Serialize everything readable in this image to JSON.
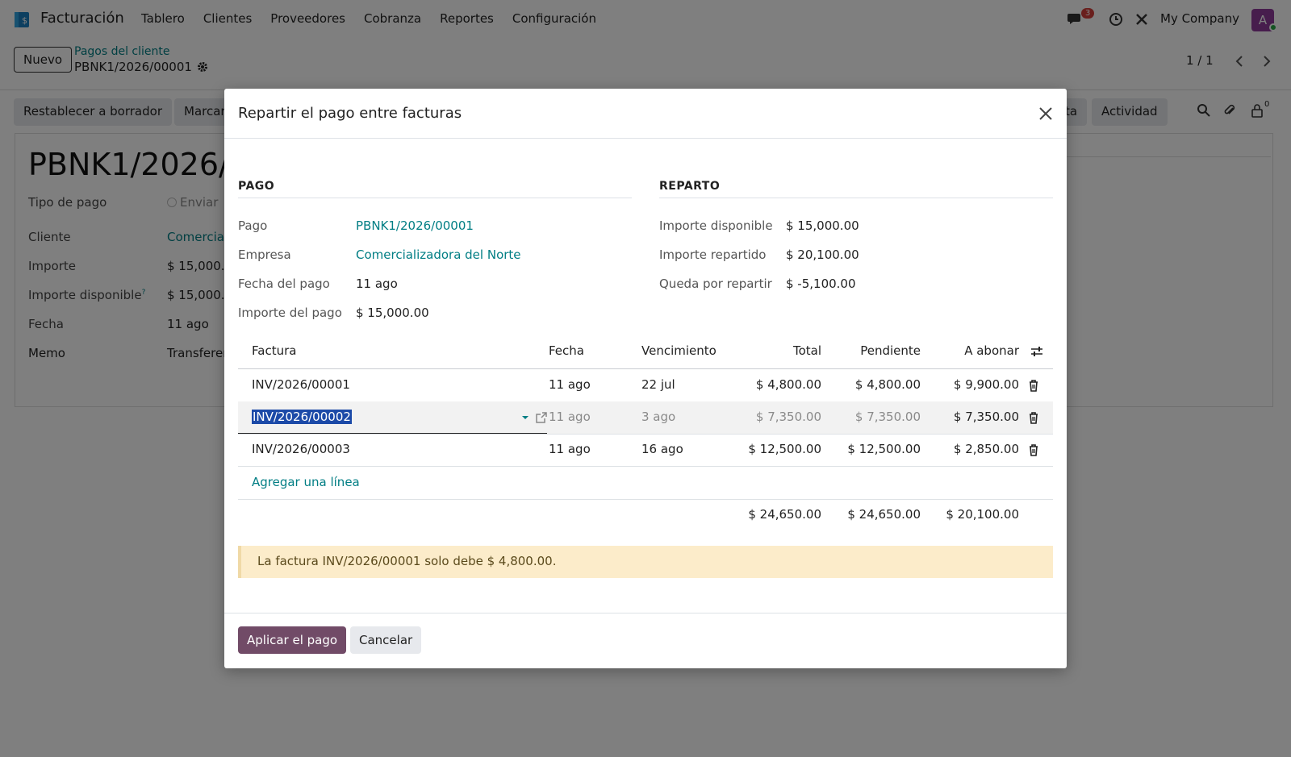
{
  "navbar": {
    "app_name": "Facturación",
    "menu": [
      "Tablero",
      "Clientes",
      "Proveedores",
      "Cobranza",
      "Reportes",
      "Configuración"
    ],
    "messages_count": "3",
    "company": "My Company",
    "avatar_initial": "A"
  },
  "control": {
    "new_button": "Nuevo",
    "breadcrumb_parent": "Pagos del cliente",
    "breadcrumb_current": "PBNK1/2026/00001",
    "pager": "1 / 1"
  },
  "statusbar": {
    "reset_button": "Restablecer a borrador",
    "mark_button": "Marcar",
    "note_button": "ta",
    "activity_button": "Actividad",
    "followers_count": "0"
  },
  "sheet": {
    "title": "PBNK1/2026/0",
    "payment_type_label": "Tipo de pago",
    "payment_type_value": "Enviar",
    "customer_label": "Cliente",
    "customer_value": "Comercia",
    "amount_label": "Importe",
    "amount_value": "$ 15,000.",
    "available_label": "Importe disponible",
    "available_help": "?",
    "available_value": "$ 15,000.",
    "date_label": "Fecha",
    "date_value": "11 ago",
    "memo_label": "Memo",
    "memo_value": "Transferer"
  },
  "modal": {
    "title": "Repartir el pago entre facturas",
    "payment_section": "PAGO",
    "distribution_section": "REPARTO",
    "payment_fields": [
      {
        "label": "Pago",
        "value": "PBNK1/2026/00001"
      },
      {
        "label": "Empresa",
        "value": "Comercializadora del Norte"
      },
      {
        "label": "Fecha del pago",
        "value": "11 ago"
      },
      {
        "label": "Importe del pago",
        "value": "$ 15,000.00"
      }
    ],
    "distribution_fields": [
      {
        "label": "Importe disponible",
        "value": "$ 15,000.00"
      },
      {
        "label": "Importe repartido",
        "value": "$ 20,100.00"
      },
      {
        "label": "Queda por repartir",
        "value": "$ -5,100.00"
      }
    ],
    "table": {
      "headers": [
        "Factura",
        "Fecha",
        "Vencimiento",
        "Total",
        "Pendiente",
        "A abonar"
      ],
      "rows": [
        {
          "invoice": "INV/2026/00001",
          "date": "11 ago",
          "due": "22 jul",
          "total": "$ 4,800.00",
          "pending": "$ 4,800.00",
          "apply": "$ 9,900.00"
        },
        {
          "invoice": "INV/2026/00002",
          "date": "11 ago",
          "due": "3 ago",
          "total": "$ 7,350.00",
          "pending": "$ 7,350.00",
          "apply": "$ 7,350.00"
        },
        {
          "invoice": "INV/2026/00003",
          "date": "11 ago",
          "due": "16 ago",
          "total": "$ 12,500.00",
          "pending": "$ 12,500.00",
          "apply": "$ 2,850.00"
        }
      ],
      "add_line": "Agregar una línea",
      "totals": {
        "total": "$ 24,650.00",
        "pending": "$ 24,650.00",
        "apply": "$ 20,100.00"
      }
    },
    "warning": "La factura INV/2026/00001 solo debe $ 4,800.00.",
    "apply_button": "Aplicar el pago",
    "cancel_button": "Cancelar"
  }
}
